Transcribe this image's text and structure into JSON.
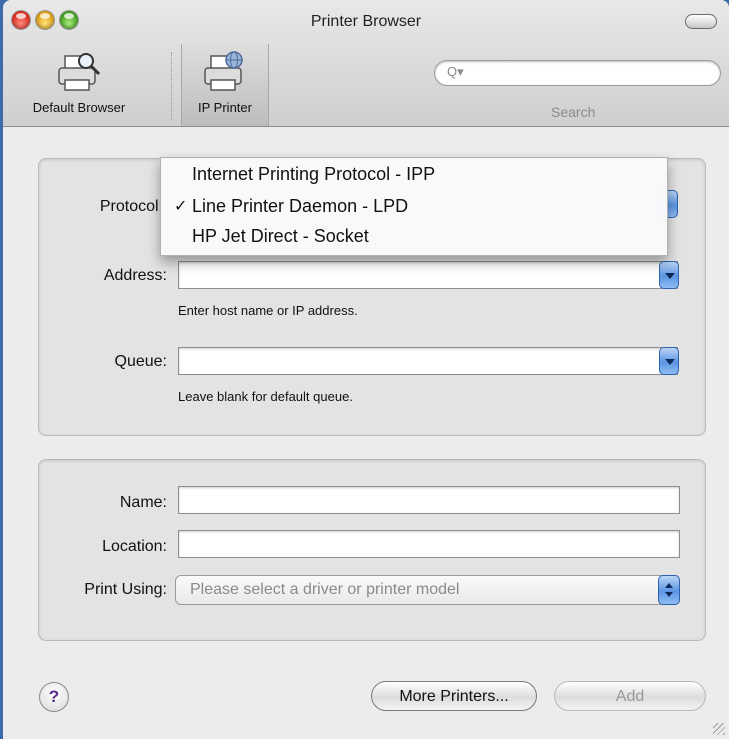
{
  "window": {
    "title": "Printer Browser"
  },
  "toolbar": {
    "items": [
      {
        "label": "Default Browser",
        "icon": "printer-magnifier-icon"
      },
      {
        "label": "IP Printer",
        "icon": "printer-globe-icon"
      }
    ],
    "search": {
      "placeholder": "Q▾",
      "label": "Search"
    }
  },
  "form": {
    "protocol": {
      "label": "Protocol:"
    },
    "address": {
      "label": "Address:",
      "value": "",
      "hint": "Enter host name or IP address."
    },
    "queue": {
      "label": "Queue:",
      "value": "",
      "hint": "Leave blank for default queue."
    },
    "name": {
      "label": "Name:",
      "value": ""
    },
    "location": {
      "label": "Location:",
      "value": ""
    },
    "print_using": {
      "label": "Print Using:",
      "value": "Please select a driver or printer model"
    }
  },
  "protocol_menu": {
    "items": [
      {
        "label": "Internet Printing Protocol - IPP",
        "check": ""
      },
      {
        "label": "Line Printer Daemon - LPD",
        "check": "✓"
      },
      {
        "label": "HP Jet Direct - Socket",
        "check": ""
      }
    ]
  },
  "buttons": {
    "help": "?",
    "more_printers": "More Printers...",
    "add": "Add"
  }
}
